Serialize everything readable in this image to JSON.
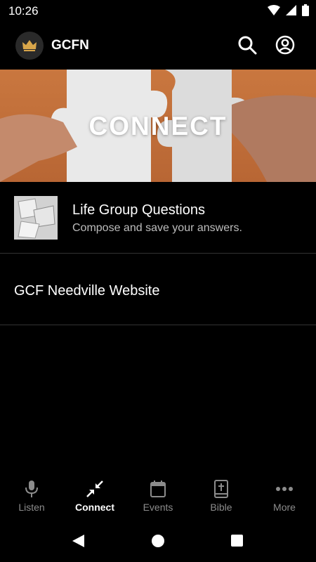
{
  "status": {
    "time": "10:26"
  },
  "app": {
    "name": "GCFN"
  },
  "hero": {
    "title": "CONNECT"
  },
  "items": [
    {
      "title": "Life Group Questions",
      "subtitle": "Compose and save your answers."
    },
    {
      "title": "GCF Needville Website"
    }
  ],
  "nav": {
    "tabs": [
      {
        "label": "Listen",
        "icon": "microphone-icon"
      },
      {
        "label": "Connect",
        "icon": "connect-icon",
        "active": true
      },
      {
        "label": "Events",
        "icon": "calendar-icon"
      },
      {
        "label": "Bible",
        "icon": "bible-icon"
      },
      {
        "label": "More",
        "icon": "more-icon"
      }
    ]
  },
  "colors": {
    "background": "#000000",
    "hero": "#c9773f",
    "inactive": "#8c8c8c"
  }
}
